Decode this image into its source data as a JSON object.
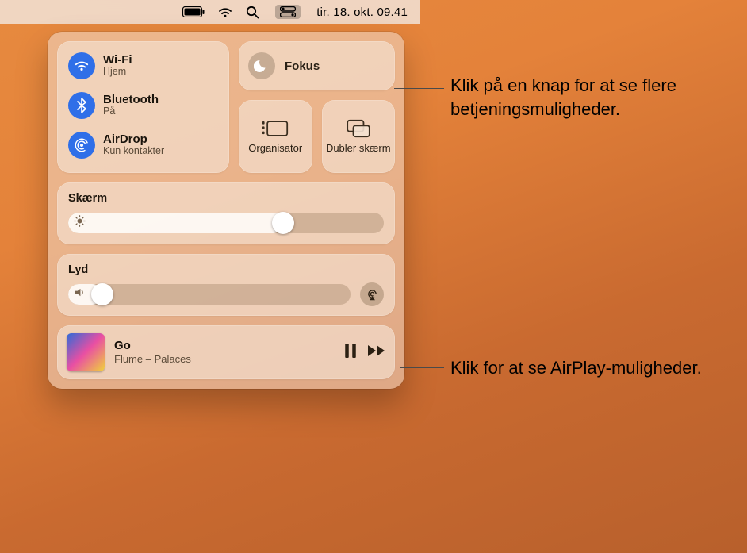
{
  "menubar": {
    "date_time": "tir. 18. okt.  09.41"
  },
  "connectivity": {
    "wifi": {
      "label": "Wi-Fi",
      "status": "Hjem"
    },
    "bluetooth": {
      "label": "Bluetooth",
      "status": "På"
    },
    "airdrop": {
      "label": "AirDrop",
      "status": "Kun kontakter"
    }
  },
  "focus": {
    "label": "Fokus"
  },
  "mini": {
    "stage_manager": "Organisator",
    "screen_mirroring": "Dubler skærm"
  },
  "display": {
    "label": "Skærm",
    "value_percent": 68
  },
  "sound": {
    "label": "Lyd",
    "value_percent": 12
  },
  "now_playing": {
    "title": "Go",
    "subtitle": "Flume – Palaces"
  },
  "callouts": {
    "top": "Klik på en knap for at se flere betjeningsmuligheder.",
    "airplay": "Klik for at se AirPlay-muligheder."
  }
}
